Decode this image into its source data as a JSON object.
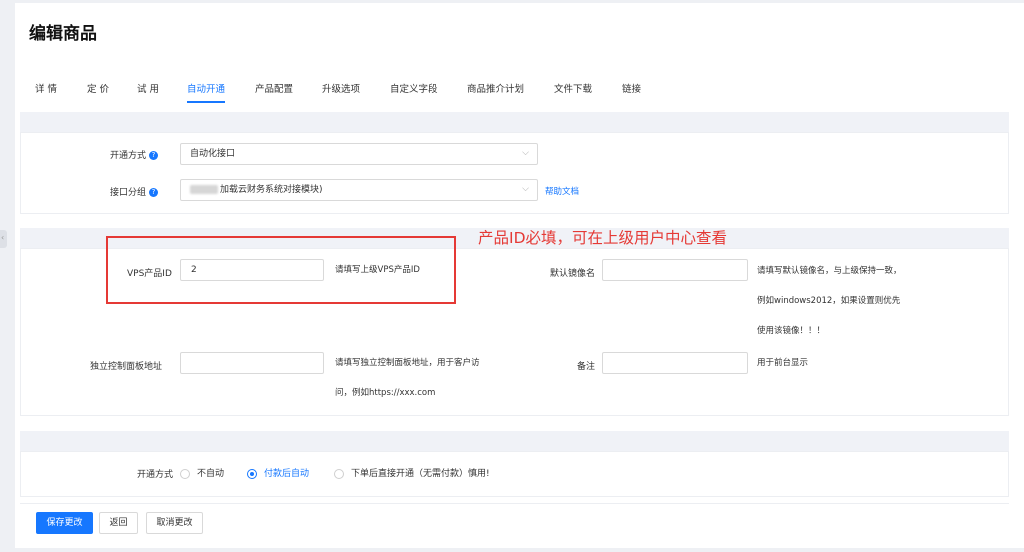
{
  "page_title": "编辑商品",
  "tabs": [
    {
      "label": "详 情"
    },
    {
      "label": "定 价"
    },
    {
      "label": "试 用"
    },
    {
      "label": "自动开通"
    },
    {
      "label": "产品配置"
    },
    {
      "label": "升级选项"
    },
    {
      "label": "自定义字段"
    },
    {
      "label": "商品推介计划"
    },
    {
      "label": "文件下载"
    },
    {
      "label": "链接"
    }
  ],
  "active_tab": "自动开通",
  "section1": {
    "open_mode_label": "开通方式",
    "open_mode_value": "自动化接口",
    "api_group_label": "接口分组",
    "api_group_value": "加载云财务系统对接模块)",
    "help_doc_link": "帮助文档"
  },
  "section2": {
    "vps_id_label": "VPS产品ID",
    "vps_id_value": "2",
    "vps_id_hint": "请填写上级VPS产品ID",
    "default_image_label": "默认镜像名",
    "default_image_hint": "请填写默认镜像名，与上级保持一致，例如windows2012，如果设置则优先使用该镜像！！！",
    "panel_addr_label": "独立控制面板地址",
    "panel_addr_hint": "请填写独立控制面板地址，用于客户访问，例如https://xxx.com",
    "remark_label": "备注",
    "remark_hint": "用于前台显示"
  },
  "annotation": {
    "text": "产品ID必填，可在上级用户中心查看"
  },
  "section3": {
    "open_mode_label": "开通方式",
    "options": [
      {
        "label": "不自动",
        "checked": false
      },
      {
        "label": "付款后自动",
        "checked": true
      },
      {
        "label": "下单后直接开通（无需付款）慎用!",
        "checked": false
      }
    ]
  },
  "footer": {
    "save_label": "保存更改",
    "back_label": "返回",
    "cancel_label": "取消更改"
  },
  "colors": {
    "accent": "#1677ff",
    "annotation": "#e53935"
  }
}
